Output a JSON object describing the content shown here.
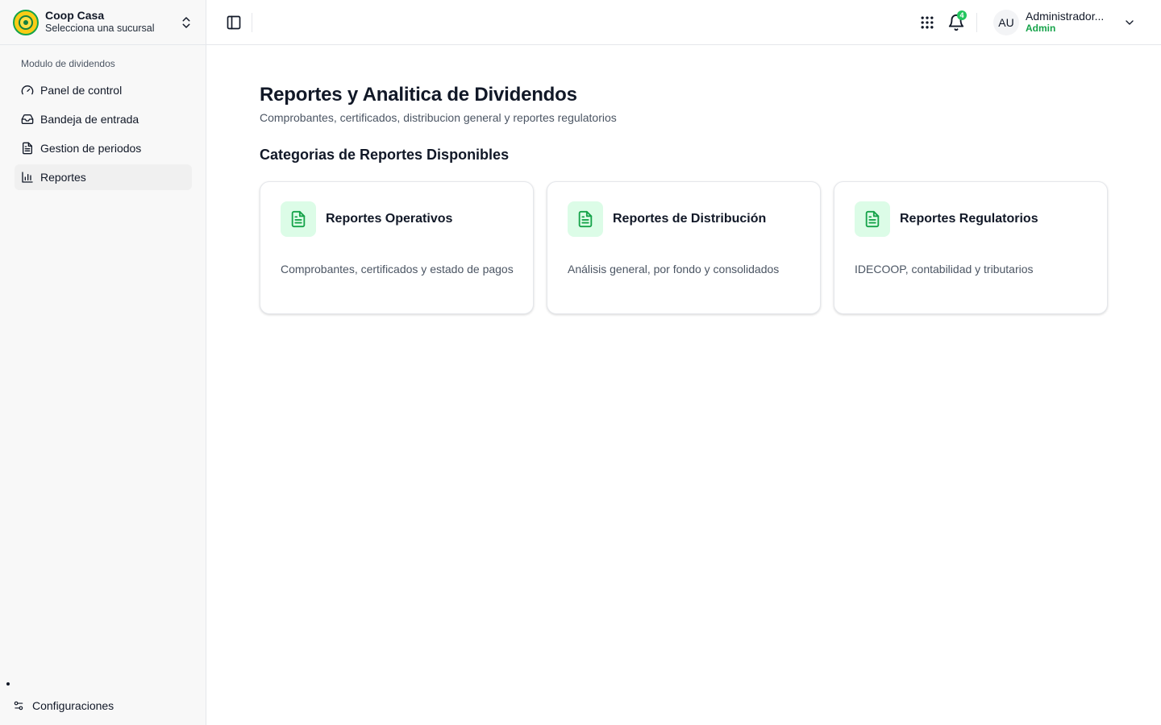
{
  "sidebar": {
    "brand_name": "Coop Casa",
    "brand_sub": "Selecciona una sucursal",
    "section_label": "Modulo de dividendos",
    "items": [
      {
        "label": "Panel de control",
        "icon": "gauge-icon"
      },
      {
        "label": "Bandeja de entrada",
        "icon": "inbox-icon"
      },
      {
        "label": "Gestion de periodos",
        "icon": "file-text-icon"
      },
      {
        "label": "Reportes",
        "icon": "bar-chart-icon",
        "active": true
      }
    ],
    "settings_label": "Configuraciones"
  },
  "header": {
    "notification_count": "4",
    "avatar_initials": "AU",
    "user_name": "Administrador...",
    "user_role": "Admin"
  },
  "main": {
    "title": "Reportes y Analitica de Dividendos",
    "subtitle": "Comprobantes, certificados, distribucion general y reportes regulatorios",
    "section_title": "Categorias de Reportes Disponibles",
    "cards": [
      {
        "title": "Reportes Operativos",
        "description": "Comprobantes, certificados y estado de pagos"
      },
      {
        "title": "Reportes de Distribución",
        "description": "Análisis general, por fondo y consolidados"
      },
      {
        "title": "Reportes Regulatorios",
        "description": "IDECOOP, contabilidad y tributarios"
      }
    ]
  },
  "colors": {
    "accent": "#16a34a",
    "accent_light": "#dcfce7",
    "sidebar_bg": "#f8f8f8"
  }
}
